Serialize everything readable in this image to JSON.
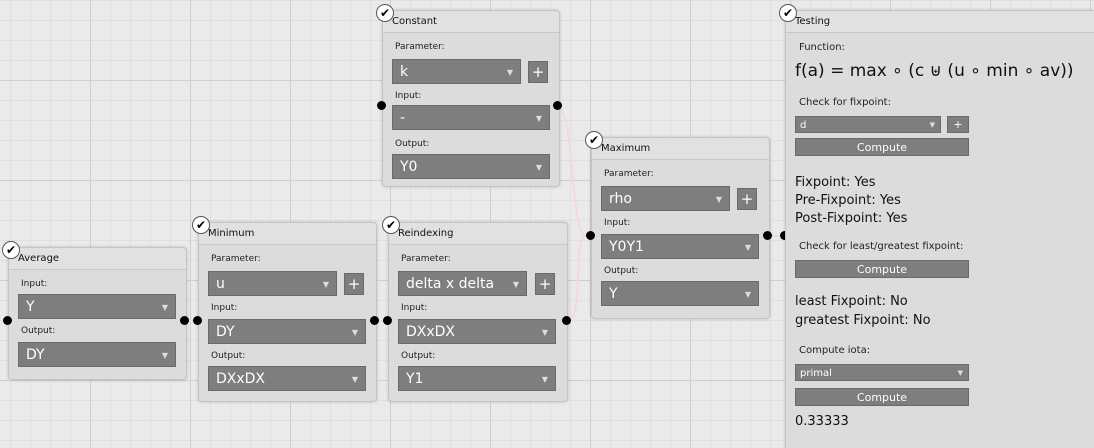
{
  "nodes": {
    "average": {
      "title": "Average",
      "input_label": "Input:",
      "input_value": "Y",
      "output_label": "Output:",
      "output_value": "DY"
    },
    "minimum": {
      "title": "Minimum",
      "parameter_label": "Parameter:",
      "parameter_value": "u",
      "add_label": "+",
      "input_label": "Input:",
      "input_value": "DY",
      "output_label": "Output:",
      "output_value": "DXxDX"
    },
    "constant": {
      "title": "Constant",
      "parameter_label": "Parameter:",
      "parameter_value": "k",
      "add_label": "+",
      "input_label": "Input:",
      "input_value": "-",
      "output_label": "Output:",
      "output_value": "Y0"
    },
    "reindexing": {
      "title": "Reindexing",
      "parameter_label": "Parameter:",
      "parameter_value": "delta x delta",
      "add_label": "+",
      "input_label": "Input:",
      "input_value": "DXxDX",
      "output_label": "Output:",
      "output_value": "Y1"
    },
    "maximum": {
      "title": "Maximum",
      "parameter_label": "Parameter:",
      "parameter_value": "rho",
      "add_label": "+",
      "input_label": "Input:",
      "input_value": "Y0Y1",
      "output_label": "Output:",
      "output_value": "Y"
    }
  },
  "check_glyph": "✔",
  "dropdown_arrow": "▼",
  "testing": {
    "title": "Testing",
    "function_label": "Function:",
    "function_formula": "f(a) = max ∘ (c ⊎ (u ∘ min ∘ av))",
    "fixpoint_check_label": "Check for fixpoint:",
    "fixpoint_select_value": "d",
    "fixpoint_add_label": "+",
    "compute_label": "Compute",
    "fixpoint_result": "Fixpoint: Yes",
    "pre_fixpoint_result": "Pre-Fixpoint: Yes",
    "post_fixpoint_result": "Post-Fixpoint: Yes",
    "least_greatest_label": "Check for least/greatest fixpoint:",
    "least_result": "least Fixpoint: No",
    "greatest_result": "greatest Fixpoint: No",
    "iota_label": "Compute iota:",
    "iota_select_value": "primal",
    "iota_result": "0.33333"
  },
  "colors": {
    "wire": "#f2d7e8",
    "node_bg": "#dcdcdc",
    "control_bg": "#7e7e7e"
  }
}
